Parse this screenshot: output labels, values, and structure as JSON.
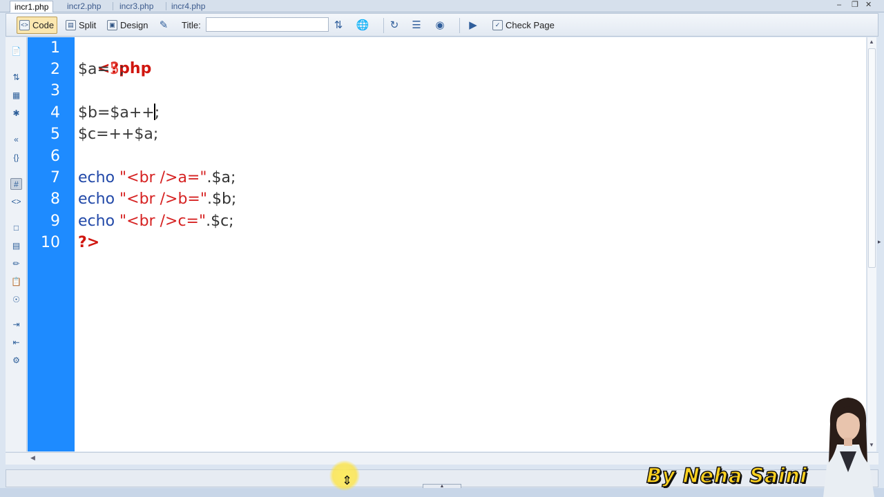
{
  "tabs": [
    {
      "label": "incr1.php",
      "active": true
    },
    {
      "label": "incr2.php",
      "active": false
    },
    {
      "label": "incr3.php",
      "active": false
    },
    {
      "label": "incr4.php",
      "active": false
    }
  ],
  "toolbar": {
    "code_label": "Code",
    "split_label": "Split",
    "design_label": "Design",
    "title_label": "Title:",
    "title_value": "",
    "check_page_label": "Check Page",
    "active_view": "Code"
  },
  "editor": {
    "line_numbers": [
      "1",
      "2",
      "3",
      "4",
      "5",
      "6",
      "7",
      "8",
      "9",
      "10"
    ],
    "lines": {
      "l1_tag": "<?php",
      "l2_var": "$a=",
      "l2_num": "5",
      "l2_end": ";",
      "l4_before_caret": "$b=$a++",
      "l4_after_caret": ";",
      "l5_code": "$c=++$a;",
      "l7_kw": "echo",
      "l7_str": " \"<br />a=\"",
      "l7_rest": ".$a;",
      "l8_kw": "echo",
      "l8_str": " \"<br />b=\"",
      "l8_rest": ".$b;",
      "l9_kw": "echo",
      "l9_str": " \"<br />c=\"",
      "l9_rest": ".$c;",
      "l10_tag": "?>"
    },
    "caret_line": 4
  },
  "watermark": {
    "text": "By Neha Saini"
  },
  "colors": {
    "gutter": "#1e8bff",
    "php_tag": "#d0160f",
    "keyword": "#2148a8",
    "string": "#d62222",
    "number": "#e8443b",
    "watermark_fill": "#ffd21f"
  }
}
